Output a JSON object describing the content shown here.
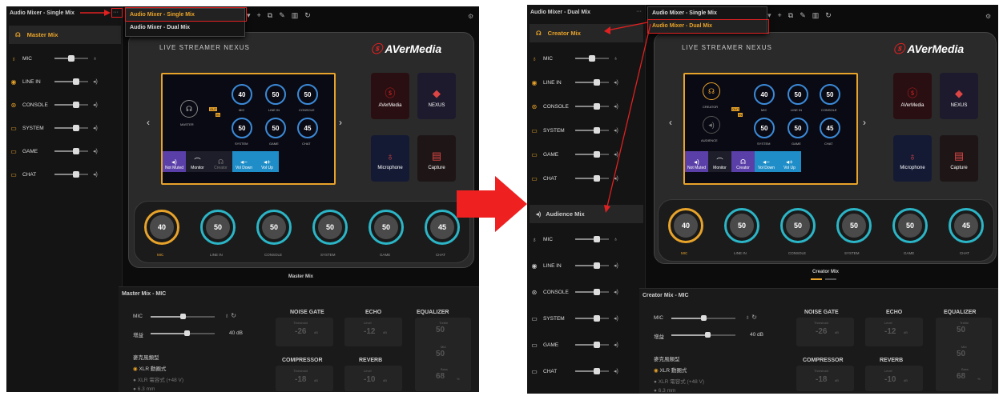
{
  "menu": {
    "single": "Audio Mixer - Single Mix",
    "dual": "Audio Mixer - Dual Mix"
  },
  "left": {
    "title": "Audio Mixer - Single Mix",
    "group": "Master Mix",
    "channels": [
      {
        "name": "MIC",
        "vol": 0.3
      },
      {
        "name": "LINE IN",
        "vol": 0.5
      },
      {
        "name": "CONSOLE",
        "vol": 0.5
      },
      {
        "name": "SYSTEM",
        "vol": 0.5
      },
      {
        "name": "GAME",
        "vol": 0.5
      },
      {
        "name": "CHAT",
        "vol": 0.5
      }
    ],
    "device": {
      "brand": "LIVE STREAMER NEXUS",
      "logo": "AVerMedia",
      "master": "MASTER",
      "badge_out": "OUT",
      "badge_in": "IN",
      "rings": [
        {
          "v": "40",
          "l": "MIC"
        },
        {
          "v": "50",
          "l": "LINE IN"
        },
        {
          "v": "50",
          "l": "CONSOLE"
        },
        {
          "v": "50",
          "l": "SYSTEM"
        },
        {
          "v": "50",
          "l": "GAME"
        },
        {
          "v": "45",
          "l": "CHAT"
        }
      ],
      "buttons": [
        "Not Muted",
        "Monitor",
        "Creator",
        "Vol Down",
        "Vol Up"
      ],
      "tiles": [
        "AVerMedia",
        "NEXUS",
        "Microphone",
        "Capture"
      ]
    },
    "knobs": [
      {
        "v": "40",
        "l": "MIC"
      },
      {
        "v": "50",
        "l": "LINE IN"
      },
      {
        "v": "50",
        "l": "CONSOLE"
      },
      {
        "v": "50",
        "l": "SYSTEM"
      },
      {
        "v": "50",
        "l": "GAME"
      },
      {
        "v": "45",
        "l": "CHAT"
      }
    ],
    "mixlabel": "Master Mix",
    "bottom": {
      "title": "Master Mix - MIC",
      "mic": "MIC",
      "gain": "增益",
      "gain_val": "40 dB",
      "mic_type": "麥克風類型",
      "xlr": "XLR 動圈式",
      "xlr48": "XLR 電容式 (+48 V)",
      "mm": "6.3 mm",
      "fx": {
        "noise": "NOISE GATE",
        "noise_l": "Threshold",
        "noise_v": "-26",
        "noise_u": "dB",
        "echo": "ECHO",
        "echo_l": "Level",
        "echo_v": "-12",
        "echo_u": "dB",
        "eq": "EQUALIZER",
        "eq_t": "Treble",
        "eq_tv": "50",
        "eq_m": "Mid",
        "eq_mv": "50",
        "eq_b": "Bass",
        "eq_bv": "68",
        "pct": "%",
        "comp": "COMPRESSOR",
        "comp_l": "Threshold",
        "comp_v": "-18",
        "comp_u": "dB",
        "rev": "REVERB",
        "rev_l": "Level",
        "rev_v": "-10",
        "rev_u": "dB"
      }
    }
  },
  "right": {
    "title": "Audio Mixer - Dual Mix",
    "group1": "Creator Mix",
    "group2": "Audience Mix",
    "channels": [
      "MIC",
      "LINE IN",
      "CONSOLE",
      "SYSTEM",
      "GAME",
      "CHAT"
    ],
    "device": {
      "creator": "CREATOR",
      "audience": "AUDIENCE",
      "buttons": [
        "Not Muted",
        "Monitor",
        "Creator",
        "Vol Down",
        "Vol Up"
      ]
    },
    "mixlabel": "Creator Mix",
    "bottom_title": "Creator Mix - MIC"
  },
  "colors": {
    "accent": "#e8a32a",
    "arrow": "#e02020",
    "cyan": "#2bb5c6"
  }
}
